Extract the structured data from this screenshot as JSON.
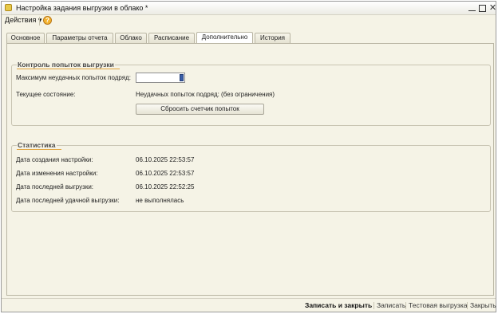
{
  "window": {
    "title": "Настройка задания выгрузки в облако *"
  },
  "menu": {
    "actions_label": "Действия ▾"
  },
  "tabs": [
    {
      "label": "Основное"
    },
    {
      "label": "Параметры отчета"
    },
    {
      "label": "Облако"
    },
    {
      "label": "Расписание"
    },
    {
      "label": "Дополнительно"
    },
    {
      "label": "История"
    }
  ],
  "active_tab": "Дополнительно",
  "retry_control": {
    "title": "Контроль попыток выгрузки",
    "max_attempts_label": "Максимум неудачных попыток подряд:",
    "max_attempts_value": "0",
    "current_state_label": "Текущее состояние:",
    "current_state_value": "Неудачных попыток подряд:  (без ограничения)",
    "reset_button": "Сбросить счетчик попыток"
  },
  "statistics": {
    "title": "Статистика",
    "rows": [
      {
        "label": "Дата создания настройки:",
        "value": "06.10.2025 22:53:57"
      },
      {
        "label": "Дата изменения настройки:",
        "value": "06.10.2025 22:53:57"
      },
      {
        "label": "Дата последней выгрузки:",
        "value": "06.10.2025 22:52:25"
      },
      {
        "label": "Дата последней удачной выгрузки:",
        "value": "не выполнялась"
      }
    ]
  },
  "footer": {
    "save_close": "Записать и закрыть",
    "save": "Записать",
    "test_upload": "Тестовая выгрузка",
    "close": "Закрыть"
  }
}
